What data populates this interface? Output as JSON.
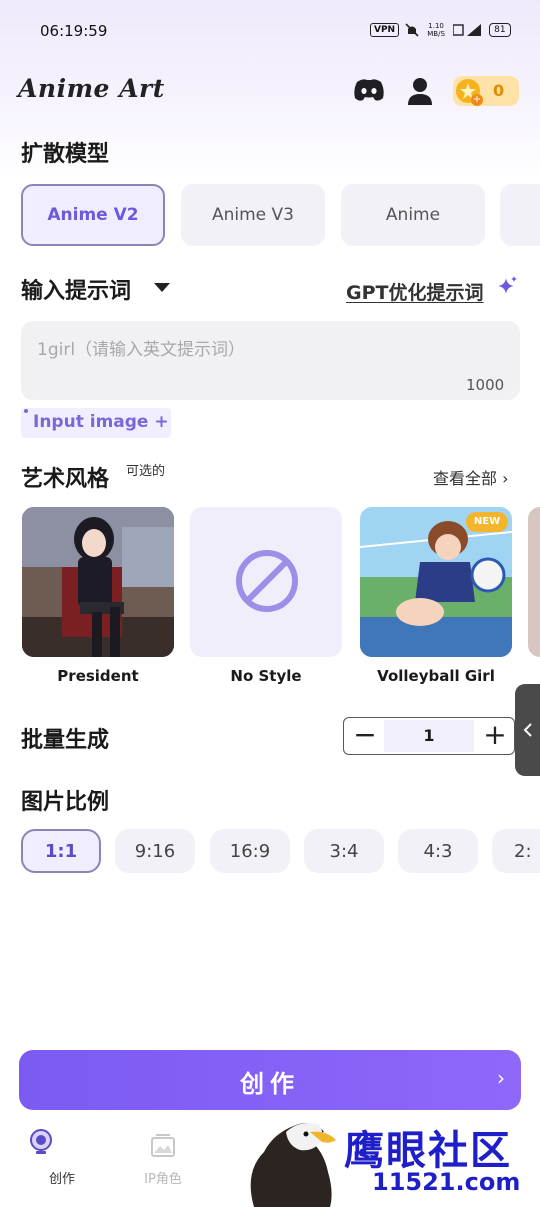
{
  "status_bar": {
    "time": "06:19:59",
    "vpn": "VPN",
    "speed": "1.10 MB/S",
    "battery": "81"
  },
  "header": {
    "title": "Anime Art",
    "coin_count": "0"
  },
  "model_section": {
    "title": "扩散模型",
    "models": [
      {
        "label": "Anime V2",
        "selected": true
      },
      {
        "label": "Anime V3",
        "selected": false
      },
      {
        "label": "Anime",
        "selected": false
      }
    ]
  },
  "prompt_section": {
    "title": "输入提示词",
    "gpt_link": "GPT优化提示词",
    "placeholder": "1girl（请输入英文提示词）",
    "char_limit": "1000",
    "input_image": "Input image +"
  },
  "style_section": {
    "title": "艺术风格",
    "optional": "可选的",
    "view_all": "查看全部 ›",
    "styles": [
      {
        "label": "President"
      },
      {
        "label": "No Style"
      },
      {
        "label": "Volleyball Girl",
        "badge": "NEW"
      }
    ]
  },
  "batch_section": {
    "title": "批量生成",
    "value": "1",
    "minus": "−",
    "plus": "+"
  },
  "ratio_section": {
    "title": "图片比例",
    "ratios": [
      {
        "label": "1:1",
        "selected": true
      },
      {
        "label": "9:16",
        "selected": false
      },
      {
        "label": "16:9",
        "selected": false
      },
      {
        "label": "3:4",
        "selected": false
      },
      {
        "label": "4:3",
        "selected": false
      },
      {
        "label": "2:",
        "selected": false
      }
    ]
  },
  "create_button": {
    "label": "创作",
    "chevron": "›"
  },
  "bottom_nav": [
    {
      "label": "创作",
      "active": true
    },
    {
      "label": "IP角色",
      "active": false
    }
  ],
  "watermark": {
    "text": "鹰眼社区",
    "url": "11521.com"
  },
  "colors": {
    "accent": "#7b5bf2",
    "selected_border": "#8b84b8",
    "chip_bg": "#f2f1f7"
  }
}
